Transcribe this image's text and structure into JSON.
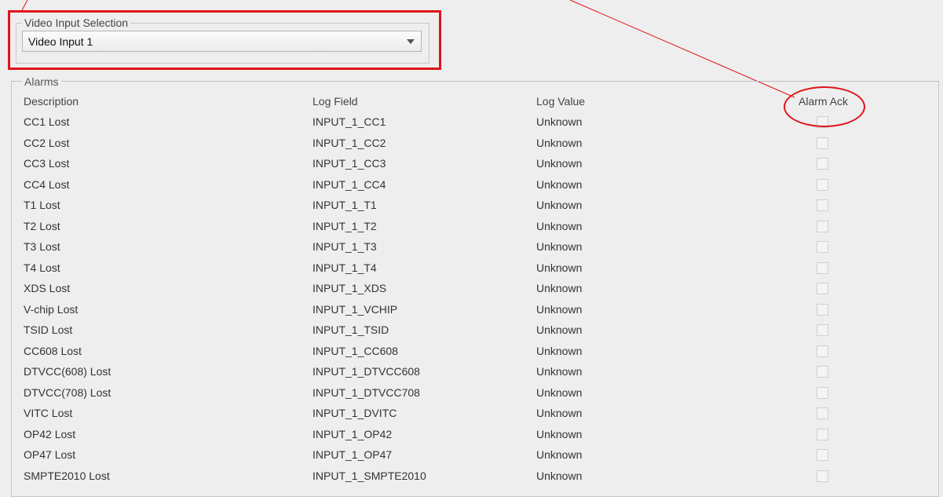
{
  "video_input": {
    "group_label": "Video Input Selection",
    "selected": "Video Input 1"
  },
  "alarms": {
    "group_label": "Alarms",
    "headers": {
      "description": "Description",
      "log_field": "Log Field",
      "log_value": "Log Value",
      "alarm_ack": "Alarm Ack"
    },
    "rows": [
      {
        "description": "CC1 Lost",
        "log_field": "INPUT_1_CC1",
        "log_value": "Unknown",
        "ack": false
      },
      {
        "description": "CC2 Lost",
        "log_field": "INPUT_1_CC2",
        "log_value": "Unknown",
        "ack": false
      },
      {
        "description": "CC3 Lost",
        "log_field": "INPUT_1_CC3",
        "log_value": "Unknown",
        "ack": false
      },
      {
        "description": "CC4 Lost",
        "log_field": "INPUT_1_CC4",
        "log_value": "Unknown",
        "ack": false
      },
      {
        "description": "T1 Lost",
        "log_field": "INPUT_1_T1",
        "log_value": "Unknown",
        "ack": false
      },
      {
        "description": "T2 Lost",
        "log_field": "INPUT_1_T2",
        "log_value": "Unknown",
        "ack": false
      },
      {
        "description": "T3 Lost",
        "log_field": "INPUT_1_T3",
        "log_value": "Unknown",
        "ack": false
      },
      {
        "description": "T4 Lost",
        "log_field": "INPUT_1_T4",
        "log_value": "Unknown",
        "ack": false
      },
      {
        "description": "XDS Lost",
        "log_field": "INPUT_1_XDS",
        "log_value": "Unknown",
        "ack": false
      },
      {
        "description": "V-chip Lost",
        "log_field": "INPUT_1_VCHIP",
        "log_value": "Unknown",
        "ack": false
      },
      {
        "description": "TSID Lost",
        "log_field": "INPUT_1_TSID",
        "log_value": "Unknown",
        "ack": false
      },
      {
        "description": "CC608 Lost",
        "log_field": "INPUT_1_CC608",
        "log_value": "Unknown",
        "ack": false
      },
      {
        "description": "DTVCC(608) Lost",
        "log_field": "INPUT_1_DTVCC608",
        "log_value": "Unknown",
        "ack": false
      },
      {
        "description": "DTVCC(708) Lost",
        "log_field": "INPUT_1_DTVCC708",
        "log_value": "Unknown",
        "ack": false
      },
      {
        "description": "VITC Lost",
        "log_field": "INPUT_1_DVITC",
        "log_value": "Unknown",
        "ack": false
      },
      {
        "description": "OP42 Lost",
        "log_field": "INPUT_1_OP42",
        "log_value": "Unknown",
        "ack": false
      },
      {
        "description": "OP47 Lost",
        "log_field": "INPUT_1_OP47",
        "log_value": "Unknown",
        "ack": false
      },
      {
        "description": "SMPTE2010 Lost",
        "log_field": "INPUT_1_SMPTE2010",
        "log_value": "Unknown",
        "ack": false
      }
    ]
  },
  "annotation_color": "#e0141b"
}
